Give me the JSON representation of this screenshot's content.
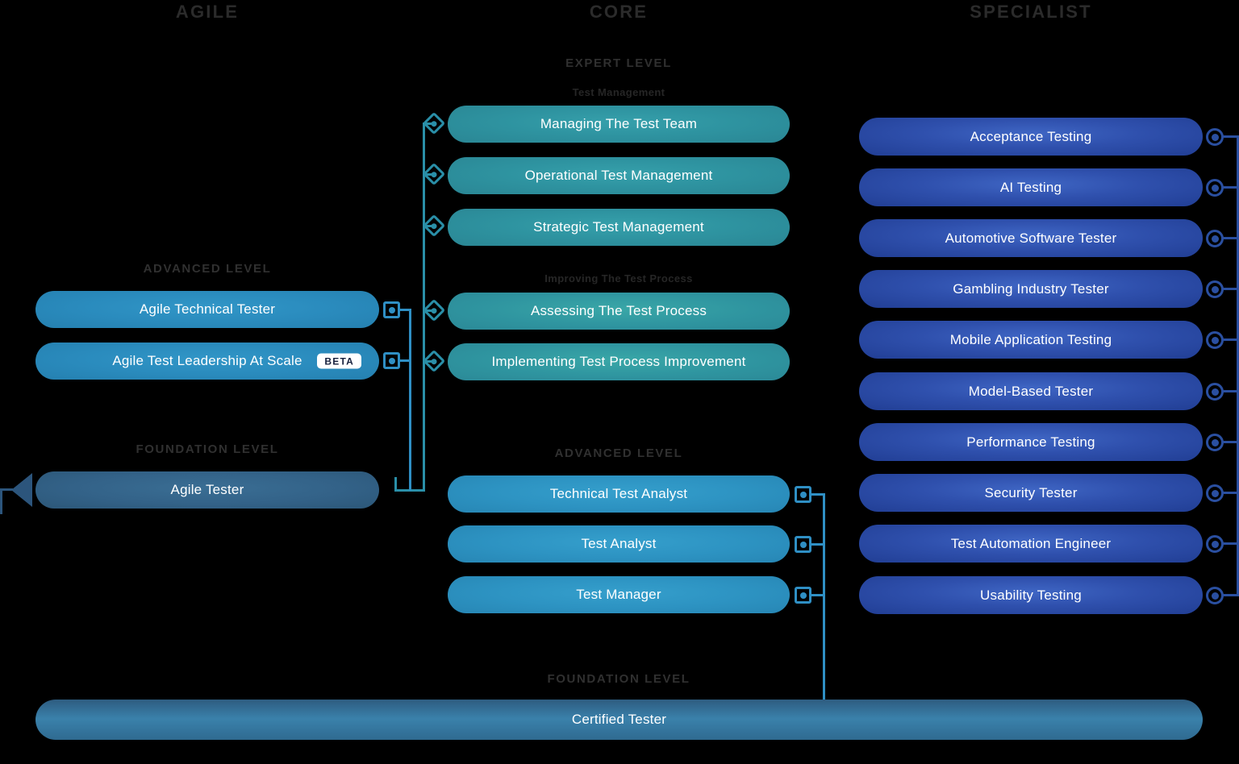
{
  "columns": {
    "agile": "AGILE",
    "core": "CORE",
    "specialist": "SPECIALIST"
  },
  "labels": {
    "expert_level": "EXPERT LEVEL",
    "test_management": "Test Management",
    "improving_the_test_process": "Improving The Test Process",
    "agile_advanced_level": "ADVANCED LEVEL",
    "agile_foundation_level": "FOUNDATION LEVEL",
    "core_advanced_level": "ADVANCED LEVEL",
    "core_foundation_level": "FOUNDATION LEVEL"
  },
  "agile": {
    "advanced": [
      {
        "label": "Agile Technical Tester",
        "badge": ""
      },
      {
        "label": "Agile Test Leadership At Scale",
        "badge": "BETA"
      }
    ],
    "foundation": [
      {
        "label": "Agile Tester",
        "badge": ""
      }
    ]
  },
  "core": {
    "expert_test_management": [
      {
        "label": "Managing The Test Team"
      },
      {
        "label": "Operational Test Management"
      },
      {
        "label": "Strategic Test Management"
      }
    ],
    "expert_improving_process": [
      {
        "label": "Assessing The Test Process"
      },
      {
        "label": "Implementing Test Process Improvement"
      }
    ],
    "advanced": [
      {
        "label": "Technical Test Analyst"
      },
      {
        "label": "Test Analyst"
      },
      {
        "label": "Test Manager"
      }
    ],
    "foundation": [
      {
        "label": "Certified Tester"
      }
    ]
  },
  "specialist": {
    "items": [
      {
        "label": "Acceptance Testing"
      },
      {
        "label": "AI Testing"
      },
      {
        "label": "Automotive Software Tester"
      },
      {
        "label": "Gambling Industry Tester"
      },
      {
        "label": "Mobile Application Testing"
      },
      {
        "label": "Model-Based Tester"
      },
      {
        "label": "Performance Testing"
      },
      {
        "label": "Security Tester"
      },
      {
        "label": "Test Automation Engineer"
      },
      {
        "label": "Usability Testing"
      }
    ]
  },
  "colors": {
    "background": "#000000",
    "heading": "#2b2b2b",
    "teal": "#2e93a0",
    "teal_green": "#2f95a0",
    "blue": "#2a8bbd",
    "royal": "#2f50ad",
    "steel": "#336288",
    "connector_teal": "#2a8fa8",
    "connector_blue": "#2f8fc4",
    "connector_royal": "#2a4fa0",
    "connector_navy": "#2c557c",
    "pill_text": "#ffffff",
    "badge_bg": "#ffffff",
    "badge_text": "#16203d"
  }
}
